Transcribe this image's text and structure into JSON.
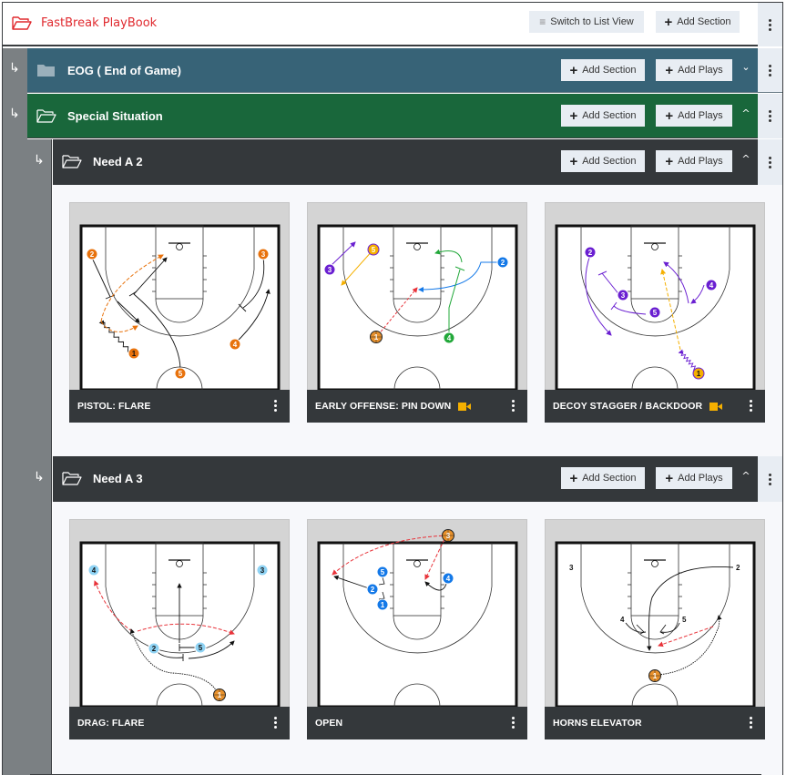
{
  "header": {
    "app_title": "FastBreak PlayBook",
    "switch_view_label": "Switch to List View",
    "add_section_label": "Add Section"
  },
  "sections": [
    {
      "title": "EOG ( End of Game)",
      "add_section_label": "Add Section",
      "add_plays_label": "Add Plays",
      "expanded": false,
      "color": "#376377"
    },
    {
      "title": "Special Situation",
      "add_section_label": "Add Section",
      "add_plays_label": "Add Plays",
      "expanded": true,
      "color": "#19673b"
    }
  ],
  "subsections": [
    {
      "title": "Need A 2",
      "add_section_label": "Add Section",
      "add_plays_label": "Add Plays",
      "expanded": true,
      "plays": [
        {
          "name": "PISTOL: FLARE",
          "has_video": false,
          "player_color": "#e8720c"
        },
        {
          "name": "EARLY OFFENSE: PIN DOWN",
          "has_video": true
        },
        {
          "name": "DECOY STAGGER / BACKDOOR",
          "has_video": true,
          "player_color": "#6a1fd1"
        }
      ]
    },
    {
      "title": "Need A 3",
      "add_section_label": "Add Section",
      "add_plays_label": "Add Plays",
      "expanded": true,
      "plays": [
        {
          "name": "DRAG: FLARE",
          "has_video": false,
          "player_color": "#8fd3f4"
        },
        {
          "name": "OPEN",
          "has_video": false,
          "player_color": "#1479e8"
        },
        {
          "name": "HORNS ELEVATOR",
          "has_video": false
        }
      ]
    }
  ],
  "icons": {
    "folder_open": "folder-open-icon",
    "folder_closed": "folder-icon",
    "indent_arrow": "↳",
    "more": "kebab-menu-icon",
    "chevron_up": "^",
    "chevron_down": "⌄",
    "video": "video-camera-icon",
    "list": "≡",
    "plus": "+"
  },
  "colors": {
    "brand": "#e02a2f",
    "video_badge": "#f5b000",
    "pass_line": "#e8333a"
  }
}
